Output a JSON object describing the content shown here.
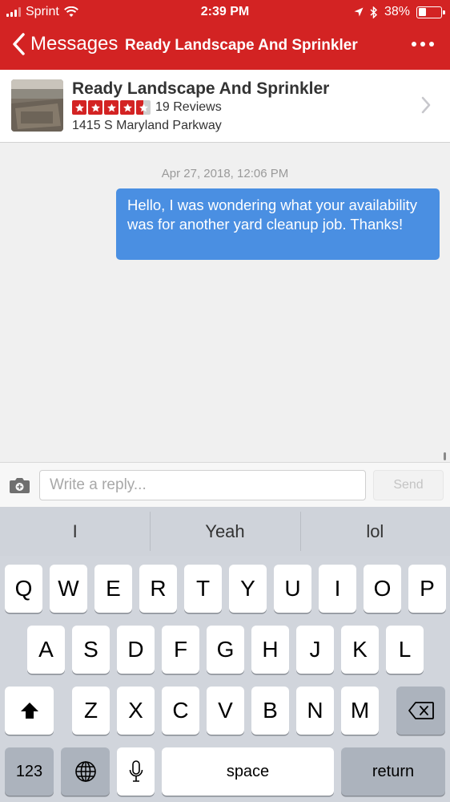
{
  "status_bar": {
    "carrier": "Sprint",
    "time": "2:39 PM",
    "battery": "38%",
    "battery_level": 0.38
  },
  "nav": {
    "back_label": "Messages",
    "title": "Ready Landscape And Sprinkler"
  },
  "business": {
    "name": "Ready Landscape And Sprinkler",
    "rating": 4.5,
    "reviews": "19 Reviews",
    "address": "1415 S Maryland Parkway"
  },
  "chat": {
    "timestamp": "Apr 27, 2018, 12:06 PM",
    "message": "Hello, I was wondering what your availability was for another yard cleanup job. Thanks!"
  },
  "reply": {
    "placeholder": "Write a reply...",
    "send_label": "Send"
  },
  "suggestions": [
    "I",
    "Yeah",
    "lol"
  ],
  "keyboard": {
    "row1": [
      "Q",
      "W",
      "E",
      "R",
      "T",
      "Y",
      "U",
      "I",
      "O",
      "P"
    ],
    "row2": [
      "A",
      "S",
      "D",
      "F",
      "G",
      "H",
      "J",
      "K",
      "L"
    ],
    "row3": [
      "Z",
      "X",
      "C",
      "V",
      "B",
      "N",
      "M"
    ],
    "numbers_label": "123",
    "space_label": "space",
    "return_label": "return"
  },
  "colors": {
    "brand_red": "#d32323",
    "bubble_blue": "#4a8fe2"
  }
}
